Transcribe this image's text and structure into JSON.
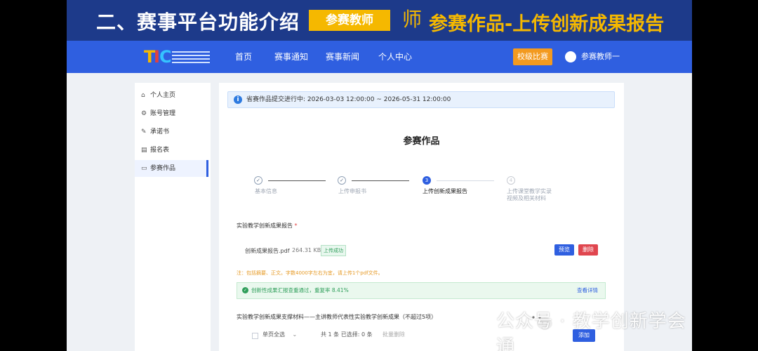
{
  "banner": {
    "title": "二、赛事平台功能介绍",
    "tag": "参赛教师",
    "emblem": "师",
    "subtitle": "参赛作品-上传创新成果报告"
  },
  "nav": {
    "items": [
      "首页",
      "赛事通知",
      "赛事新闻",
      "个人中心"
    ],
    "action_button": "校级比赛",
    "user_name": "参赛教师一"
  },
  "sidebar": {
    "items": [
      {
        "label": "个人主页",
        "icon": "home-icon"
      },
      {
        "label": "账号管理",
        "icon": "gear-icon"
      },
      {
        "label": "承诺书",
        "icon": "document-icon"
      },
      {
        "label": "报名表",
        "icon": "form-icon"
      },
      {
        "label": "参赛作品",
        "icon": "folder-icon"
      }
    ],
    "active_index": 4
  },
  "main": {
    "notice": "省赛作品提交进行中: 2026-03-03 12:00:00 ~ 2026-05-31 12:00:00",
    "title": "参赛作品",
    "steps": [
      {
        "label": "基本信息",
        "status": "done",
        "mark": "✓"
      },
      {
        "label": "上传申报书",
        "status": "done",
        "mark": "✓"
      },
      {
        "label": "上传创新成果报告",
        "status": "active",
        "mark": "3"
      },
      {
        "label_line1": "上传课堂教学实录",
        "label_line2": "视频及相关材料",
        "status": "todo",
        "mark": "4"
      }
    ],
    "report_section": {
      "label": "实验教学创新成果报告",
      "required_mark": "*",
      "file_name": "创新成果报告.pdf",
      "file_size": "264.31 KB",
      "upload_status": "上传成功",
      "preview_button": "预览",
      "delete_button": "删除",
      "note": "注：包括摘要、正文。字数4000字左右为宜，请上传1个pdf文件。",
      "check_result": "创新性成果汇报查重通过，重复率 8.41%",
      "check_detail_link": "查看详情"
    },
    "support_section": {
      "label": "实验教学创新成果支撑材料——主讲教师代表性实验教学创新成果（不超过5项）",
      "select_all": "单页全选",
      "summary": "共 1 条 已选择: 0 条",
      "batch_delete": "批量删除",
      "add_button": "添加"
    }
  },
  "watermark": {
    "text": "公众号 · 教学创新学会通"
  },
  "colors": {
    "banner_bg": "#1d3a8a",
    "nav_bg": "#2f5fe0",
    "accent_orange": "#f39a1f",
    "banner_yellow": "#f5b800",
    "success_green": "#2f9e5a",
    "danger_red": "#e0464f"
  }
}
